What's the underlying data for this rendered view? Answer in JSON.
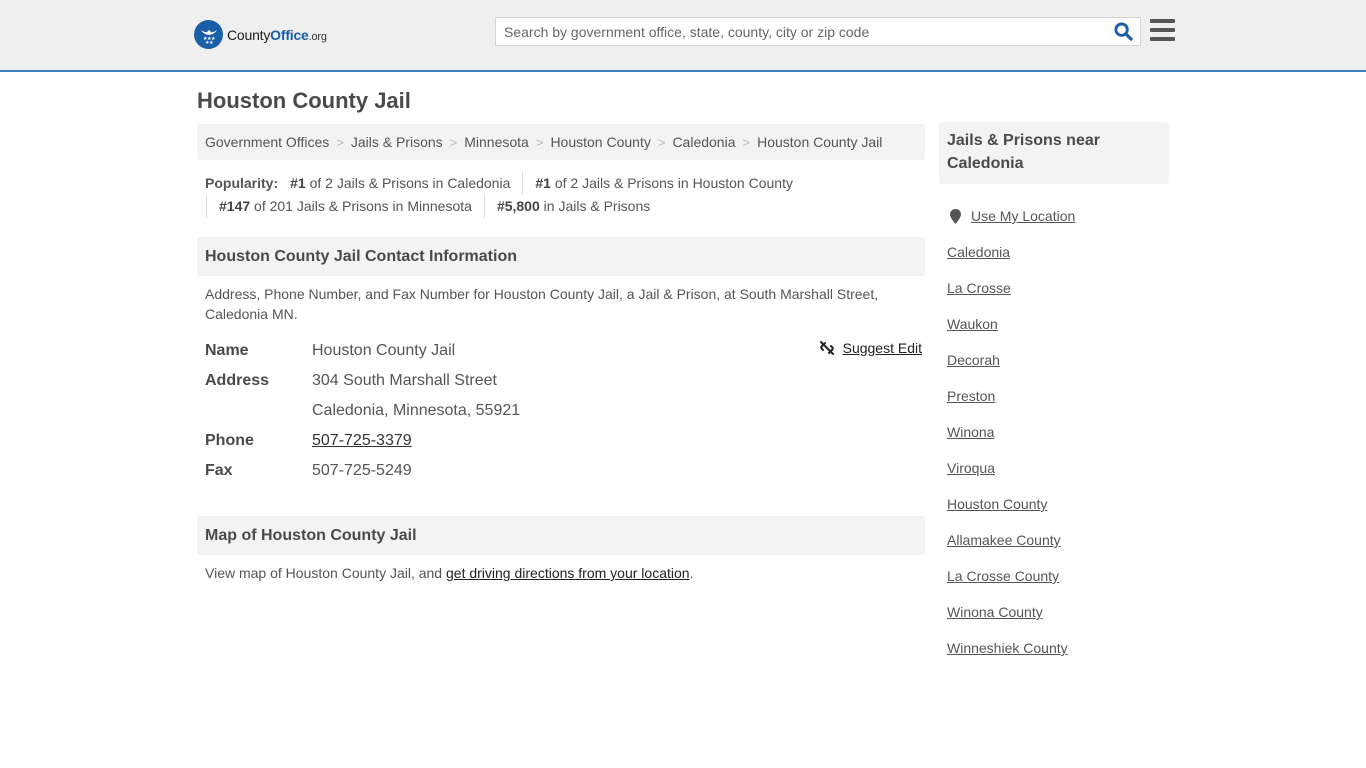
{
  "header": {
    "logo": {
      "text_main": "County",
      "text_brand": "Office",
      "text_suffix": ".org",
      "icon": "eagle-stars-badge-icon",
      "brand_color": "#1a5ea8"
    },
    "search": {
      "placeholder": "Search by government office, state, county, city or zip code",
      "value": "",
      "icon": "search-icon"
    },
    "menu_icon": "hamburger-menu-icon",
    "accent_color": "#3a7bbd"
  },
  "page": {
    "title": "Houston County Jail"
  },
  "breadcrumb": [
    {
      "label": "Government Offices"
    },
    {
      "label": "Jails & Prisons"
    },
    {
      "label": "Minnesota"
    },
    {
      "label": "Houston County"
    },
    {
      "label": "Caledonia"
    },
    {
      "label": "Houston County Jail"
    }
  ],
  "popularity": {
    "label": "Popularity:",
    "items": [
      {
        "rank": "#1",
        "text": " of 2 Jails & Prisons in Caledonia"
      },
      {
        "rank": "#1",
        "text": " of 2 Jails & Prisons in Houston County"
      },
      {
        "rank": "#147",
        "text": " of 201 Jails & Prisons in Minnesota"
      },
      {
        "rank": "#5,800",
        "text": " in Jails & Prisons"
      }
    ]
  },
  "contact": {
    "heading": "Houston County Jail Contact Information",
    "description": "Address, Phone Number, and Fax Number for Houston County Jail, a Jail & Prison, at South Marshall Street, Caledonia MN.",
    "suggest_edit": "Suggest Edit",
    "fields": {
      "name_label": "Name",
      "name_value": "Houston County Jail",
      "address_label": "Address",
      "address_line1": "304 South Marshall Street",
      "address_line2": "Caledonia, Minnesota, 55921",
      "phone_label": "Phone",
      "phone_value": "507-725-3379",
      "fax_label": "Fax",
      "fax_value": "507-725-5249"
    }
  },
  "map": {
    "heading": "Map of Houston County Jail",
    "text_before": "View map of Houston County Jail, and ",
    "link_text": "get driving directions from your location",
    "text_after": "."
  },
  "sidebar": {
    "heading": "Jails & Prisons near Caledonia",
    "use_location": "Use My Location",
    "links": [
      "Caledonia",
      "La Crosse",
      "Waukon",
      "Decorah",
      "Preston",
      "Winona",
      "Viroqua",
      "Houston County",
      "Allamakee County",
      "La Crosse County",
      "Winona County",
      "Winneshiek County"
    ]
  }
}
